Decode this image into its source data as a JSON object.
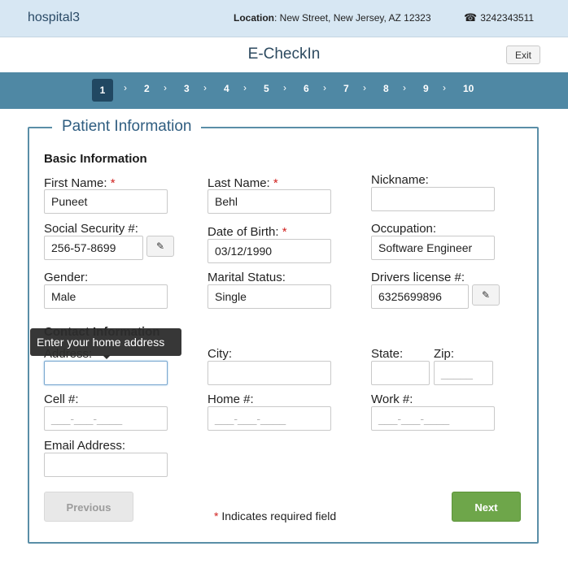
{
  "header": {
    "hospital_name": "hospital3",
    "location_label": "Location",
    "location_value": ": New Street, New Jersey, AZ 12323",
    "phone_icon": "telephone-icon",
    "phone": "3242343511"
  },
  "title_bar": {
    "title": "E-CheckIn",
    "exit_label": "Exit"
  },
  "steps": {
    "active": 1,
    "items": [
      "1",
      "2",
      "3",
      "4",
      "5",
      "6",
      "7",
      "8",
      "9",
      "10"
    ]
  },
  "panel": {
    "legend": "Patient Information",
    "basic_info_title": "Basic Information",
    "contact_info_title": "Contact Information"
  },
  "fields": {
    "first_name": {
      "label": "First Name:",
      "required": "*",
      "value": "Puneet"
    },
    "last_name": {
      "label": "Last Name:",
      "required": "*",
      "value": "Behl"
    },
    "nickname": {
      "label": "Nickname:",
      "value": ""
    },
    "ssn": {
      "label": "Social Security #:",
      "value": "256-57-8699"
    },
    "dob": {
      "label": "Date of Birth:",
      "required": "*",
      "value": "03/12/1990"
    },
    "occupation": {
      "label": "Occupation:",
      "value": "Software Engineer"
    },
    "gender": {
      "label": "Gender:",
      "value": "Male"
    },
    "marital_status": {
      "label": "Marital Status:",
      "value": "Single"
    },
    "drivers_license": {
      "label": "Drivers license #:",
      "value": "6325699896"
    },
    "address": {
      "label": "Address:",
      "value": ""
    },
    "city": {
      "label": "City:",
      "value": ""
    },
    "state": {
      "label": "State:",
      "value": ""
    },
    "zip": {
      "label": "Zip:",
      "placeholder": "_____"
    },
    "cell": {
      "label": "Cell #:",
      "placeholder": "___-___-____"
    },
    "home": {
      "label": "Home #:",
      "placeholder": "___-___-____"
    },
    "work": {
      "label": "Work #:",
      "placeholder": "___-___-____"
    },
    "email": {
      "label": "Email Address:",
      "value": ""
    }
  },
  "tooltip": {
    "text": "Enter your home address"
  },
  "footer": {
    "previous_label": "Previous",
    "next_label": "Next",
    "required_mark": "*",
    "required_note": " Indicates required field"
  },
  "colors": {
    "header_bg": "#d7e7f3",
    "stepbar_bg": "#4f88a4",
    "active_step_bg": "#214862",
    "next_button_bg": "#6ea64a",
    "frame_border": "#5a8ea7"
  }
}
